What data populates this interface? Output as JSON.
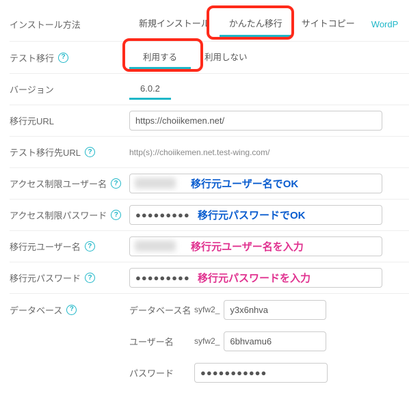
{
  "installMethod": {
    "label": "インストール方法",
    "tabs": [
      "新規インストール",
      "かんたん移行",
      "サイトコピー"
    ],
    "activeIndex": 1,
    "sideLink": "WordP"
  },
  "testMigration": {
    "label": "テスト移行",
    "options": [
      "利用する",
      "利用しない"
    ],
    "activeIndex": 0
  },
  "version": {
    "label": "バージョン",
    "value": "6.0.2"
  },
  "sourceUrl": {
    "label": "移行元URL",
    "value": "https://choiikemen.net/"
  },
  "testDestUrl": {
    "label": "テスト移行先URL",
    "value": "http(s)://choiikemen.net.test-wing.com/"
  },
  "accessUser": {
    "label": "アクセス制限ユーザー名",
    "annot": "移行元ユーザー名でOK"
  },
  "accessPass": {
    "label": "アクセス制限パスワード",
    "value": "●●●●●●●●●",
    "annot": "移行元パスワードでOK"
  },
  "srcUser": {
    "label": "移行元ユーザー名",
    "annot": "移行元ユーザー名を入力"
  },
  "srcPass": {
    "label": "移行元パスワード",
    "value": "●●●●●●●●●",
    "annot": "移行元パスワードを入力"
  },
  "database": {
    "label": "データベース",
    "dbNameLabel": "データベース名",
    "userLabel": "ユーザー名",
    "passLabel": "パスワード",
    "prefix": "syfw2_",
    "dbName": "y3x6nhva",
    "dbUser": "6bhvamu6",
    "dbPass": "●●●●●●●●●●●"
  }
}
